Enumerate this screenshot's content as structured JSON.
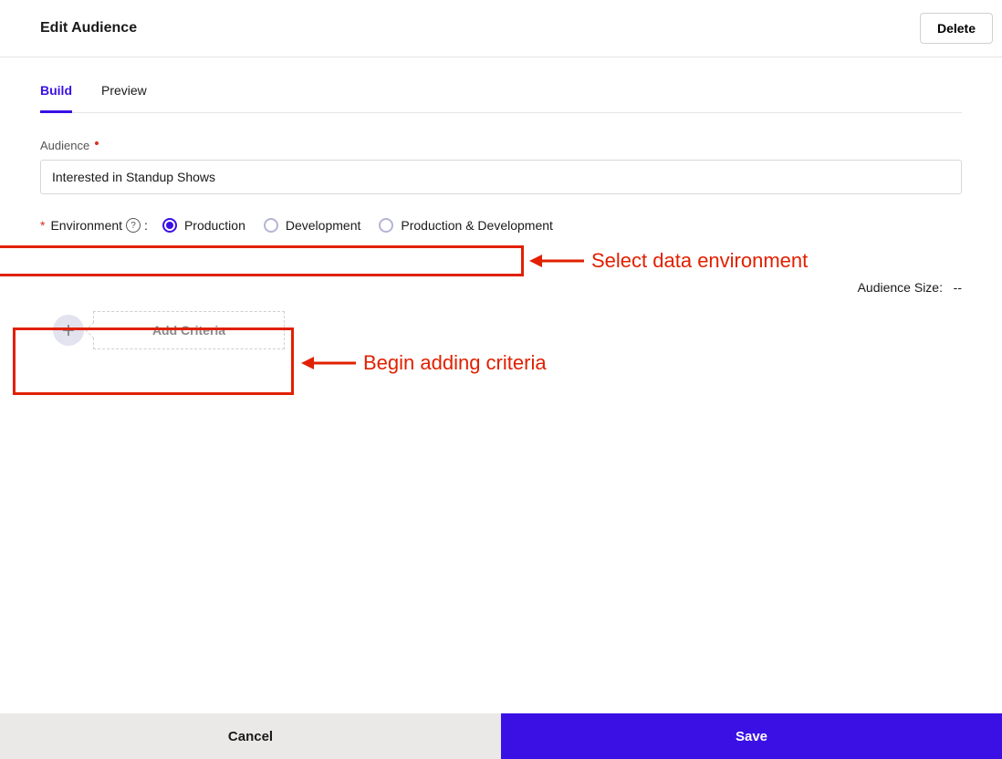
{
  "header": {
    "title": "Edit Audience",
    "delete_label": "Delete"
  },
  "tabs": [
    {
      "label": "Build",
      "active": true
    },
    {
      "label": "Preview",
      "active": false
    }
  ],
  "audience_field": {
    "label": "Audience",
    "value": "Interested in Standup Shows"
  },
  "environment": {
    "label": "Environment",
    "options": [
      {
        "label": "Production",
        "selected": true
      },
      {
        "label": "Development",
        "selected": false
      },
      {
        "label": "Production & Development",
        "selected": false
      }
    ]
  },
  "audience_size": {
    "label": "Audience Size:",
    "value": "--"
  },
  "criteria": {
    "add_label": "Add Criteria"
  },
  "annotations": {
    "env": "Select data environment",
    "criteria": "Begin adding criteria"
  },
  "footer": {
    "cancel_label": "Cancel",
    "save_label": "Save"
  }
}
